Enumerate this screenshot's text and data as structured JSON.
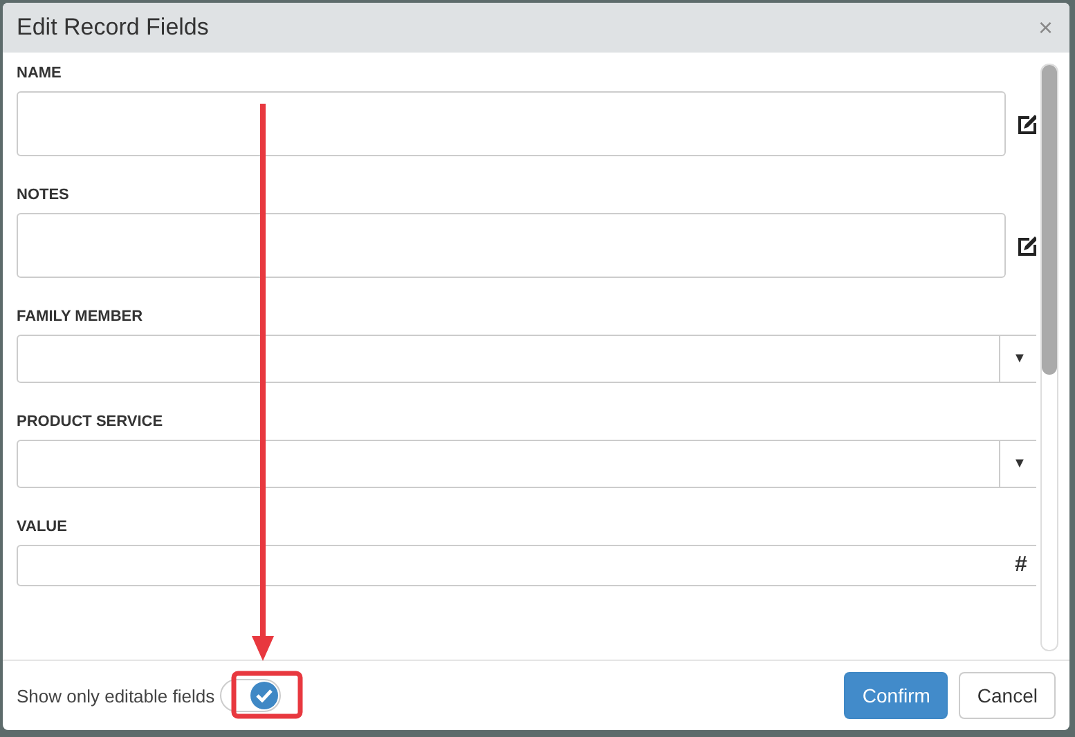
{
  "dialog": {
    "title": "Edit Record Fields",
    "close": "×"
  },
  "fields": [
    {
      "label": "NAME",
      "kind": "textarea"
    },
    {
      "label": "NOTES",
      "kind": "textarea"
    },
    {
      "label": "FAMILY MEMBER",
      "kind": "select",
      "caret": "▼"
    },
    {
      "label": "PRODUCT SERVICE",
      "kind": "select",
      "caret": "▼"
    },
    {
      "label": "VALUE",
      "kind": "number",
      "suffix": "#"
    }
  ],
  "footer": {
    "toggle_label": "Show only editable fields",
    "toggle": {
      "on": true
    },
    "buttons": [
      {
        "label": "Confirm",
        "kind": "primary"
      },
      {
        "label": "Cancel",
        "kind": "default"
      }
    ]
  }
}
